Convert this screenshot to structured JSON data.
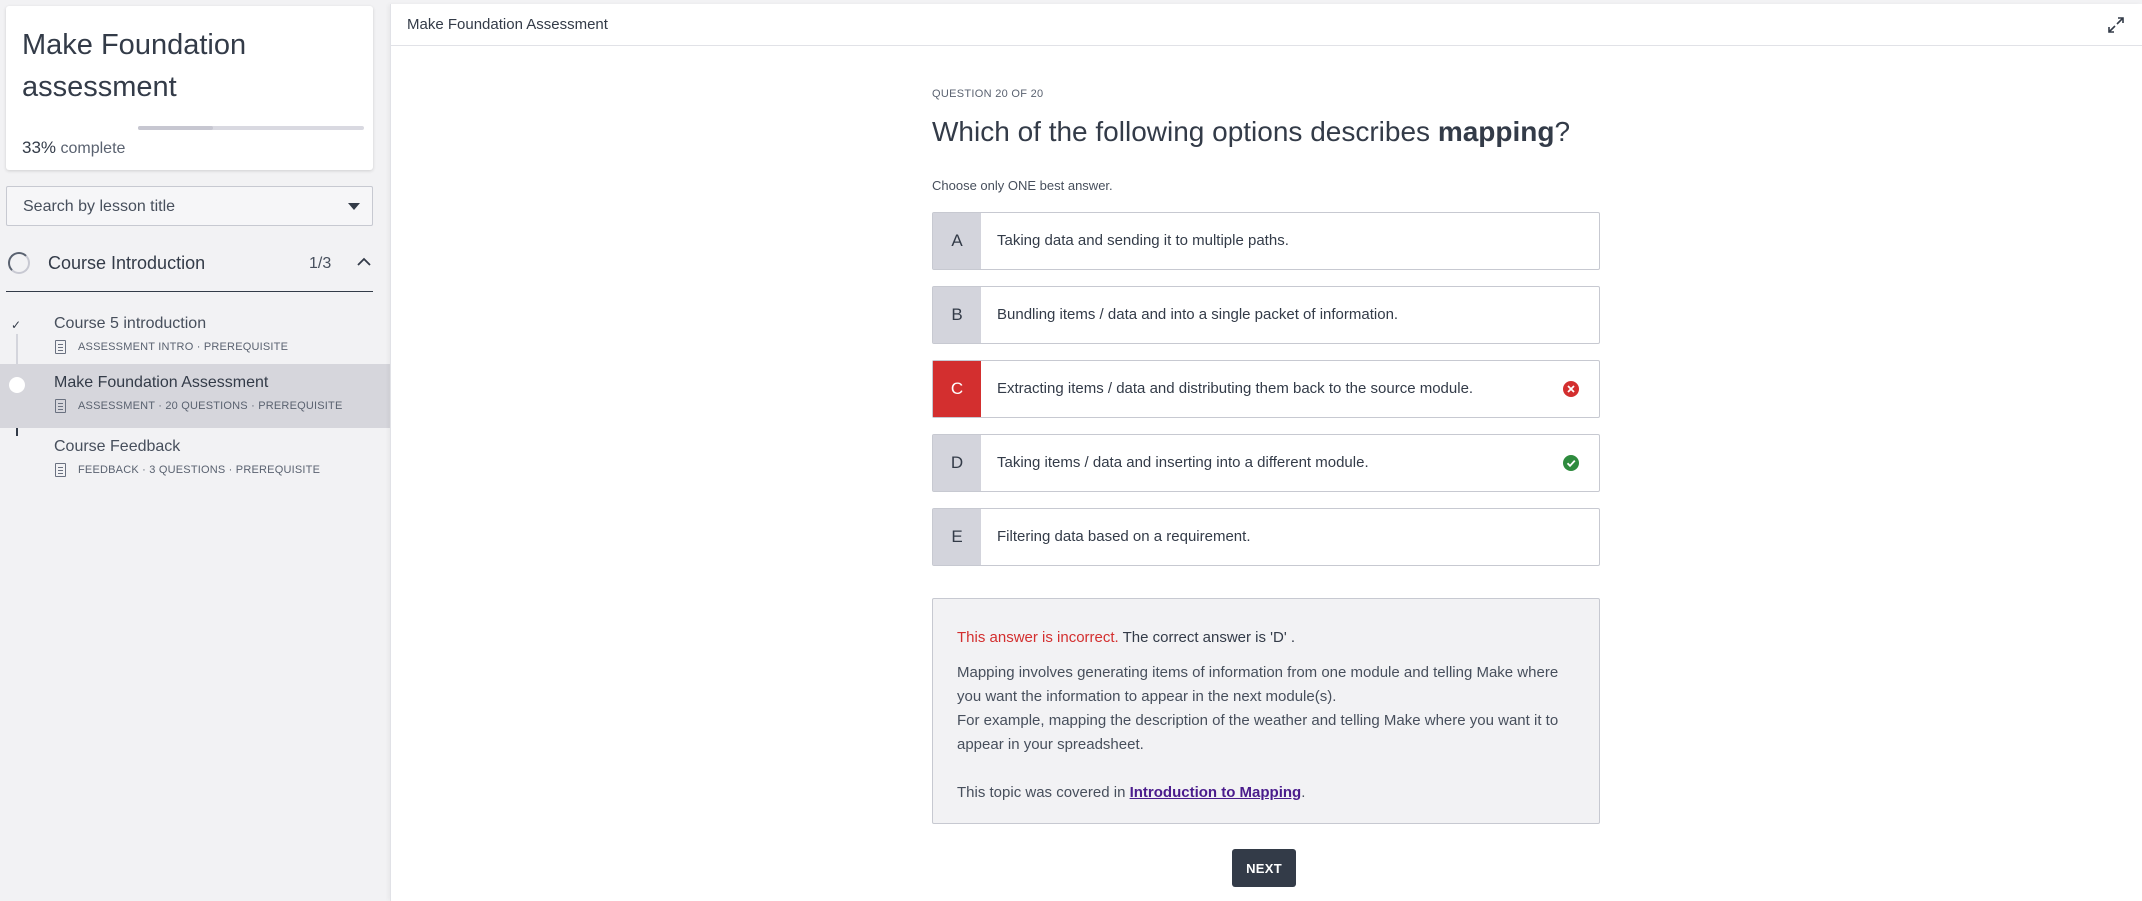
{
  "course": {
    "title": "Make Foundation assessment",
    "progress_percent": "33%",
    "progress_label": "complete",
    "progress_fraction": 0.33
  },
  "search": {
    "placeholder": "Search by lesson title"
  },
  "section": {
    "title": "Course Introduction",
    "count": "1/3"
  },
  "lessons": [
    {
      "title": "Course 5 introduction",
      "meta": "ASSESSMENT INTRO · PREREQUISITE",
      "status": "completed"
    },
    {
      "title": "Make Foundation Assessment",
      "meta": "ASSESSMENT · 20 QUESTIONS · PREREQUISITE",
      "status": "active"
    },
    {
      "title": "Course Feedback",
      "meta": "FEEDBACK · 3 QUESTIONS · PREREQUISITE",
      "status": "not-started"
    }
  ],
  "topbar": {
    "title": "Make Foundation Assessment"
  },
  "question": {
    "counter": "QUESTION 20 OF 20",
    "text_prefix": "Which of the following options describes ",
    "text_bold": "mapping",
    "text_suffix": "?",
    "instruction": "Choose only ONE best answer."
  },
  "options": [
    {
      "letter": "A",
      "text": "Taking data and sending it to multiple paths.",
      "state": "neutral"
    },
    {
      "letter": "B",
      "text": "Bundling items / data and into a single packet of information.",
      "state": "neutral"
    },
    {
      "letter": "C",
      "text": "Extracting items / data and distributing them back to the source module.",
      "state": "wrong"
    },
    {
      "letter": "D",
      "text": "Taking items / data and inserting into a different module.",
      "state": "correct"
    },
    {
      "letter": "E",
      "text": "Filtering data based on a requirement.",
      "state": "neutral"
    }
  ],
  "feedback": {
    "incorrect_label": "This answer is incorrect.",
    "correct_label": "The correct answer is 'D' .",
    "explanation_1": "Mapping involves generating items of information from one module and telling Make where you want the information to appear in the next module(s).",
    "explanation_2": "For example, mapping the description of the weather and telling Make where you want it to appear in your spreadsheet.",
    "topic_prefix": "This topic was covered in ",
    "topic_link": "Introduction to Mapping",
    "topic_suffix": "."
  },
  "next_button": {
    "label": "NEXT"
  },
  "colors": {
    "wrong": "#d32f2f",
    "correct": "#2e8b3e",
    "dark": "#333b48",
    "link": "#4a1c8c"
  }
}
